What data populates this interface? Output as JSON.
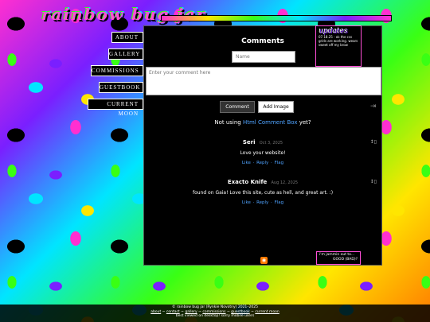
{
  "site": {
    "logo_text": "rainbow bug jar"
  },
  "nav": {
    "items": [
      "ABOUT",
      "GALLERY",
      "COMMISSIONS",
      "GUESTBOOK",
      "CURRENT MOON"
    ]
  },
  "updates": {
    "title": "updates",
    "text": "07.18.25 - ok the css grids are working. wears sweet off my brow"
  },
  "comment_box": {
    "header": "Comments",
    "name_placeholder": "Name",
    "comment_placeholder": "Enter your comment here",
    "comment_button": "Comment",
    "image_button": "Add Image",
    "not_using_prefix": "Not using",
    "not_using_link": "Html Comment Box",
    "not_using_suffix": "yet?"
  },
  "comments": [
    {
      "name": "Seri",
      "date": "Oct 3, 2025",
      "text": "Love your website!",
      "actions": [
        "Like",
        "Reply",
        "Flag"
      ]
    },
    {
      "name": "Exacto Knife",
      "date": "Aug 12, 2025",
      "text": "found on Gaia! Love this site, cute as hell, and great art. :)",
      "actions": [
        "Like",
        "Reply",
        "Flag"
      ]
    }
  ],
  "status_box": {
    "line1": "i'm jammin out to...",
    "line2": "GOOD (BAD)?"
  },
  "footer": {
    "line1": "© rainbow bug jar (Rynkie Novotny) 2021–2025",
    "links": [
      "about",
      "contact",
      "gallery",
      "commissions",
      "guestbook",
      "current moon"
    ],
    "line3": "best viewed on desktop! sorry mobile users"
  },
  "colors": {
    "accent_pink": "#ff4fd8",
    "link_blue": "#4fa3ff",
    "panel_bg": "#000000"
  }
}
